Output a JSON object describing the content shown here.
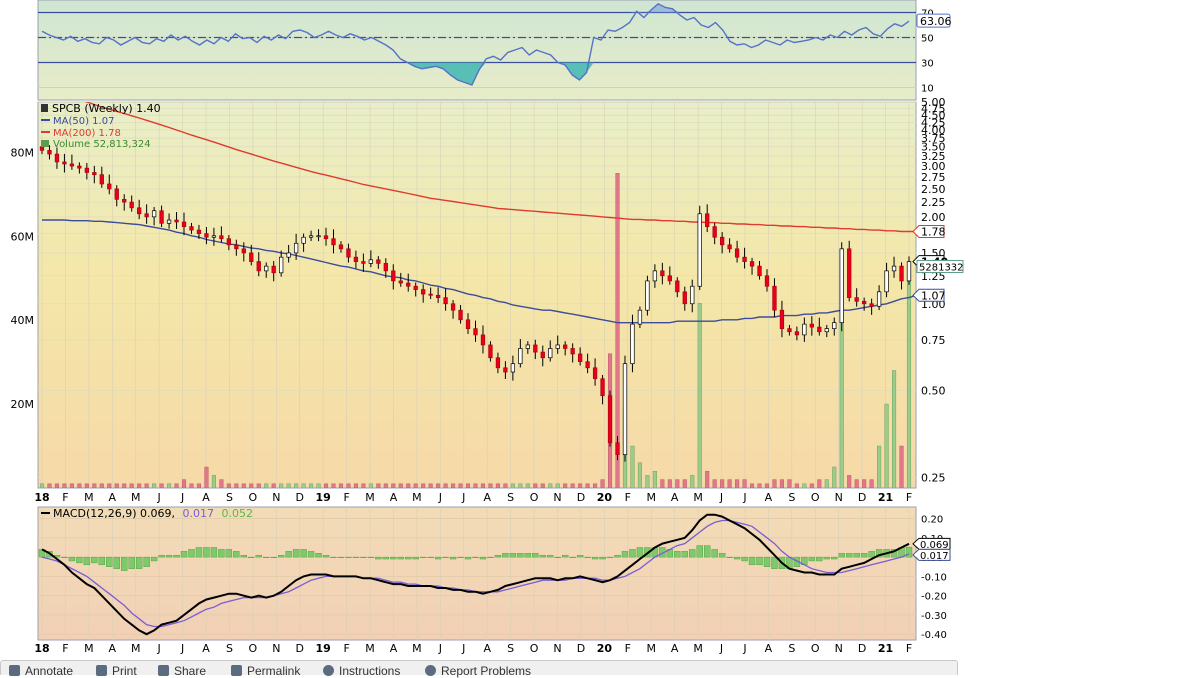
{
  "chart_data": [
    {
      "panel": "rsi",
      "type": "line",
      "y_ticks": [
        "70",
        "50",
        "30",
        "10"
      ],
      "ylim": [
        0,
        80
      ],
      "reference_lines": [
        70,
        50,
        30
      ],
      "current_value_label": "63.06",
      "series": [
        {
          "values": [
            55,
            52,
            50,
            48,
            51,
            47,
            49,
            46,
            45,
            50,
            48,
            44,
            47,
            50,
            46,
            45,
            49,
            47,
            52,
            48,
            51,
            47,
            44,
            48,
            45,
            50,
            47,
            53,
            49,
            50,
            46,
            51,
            48,
            52,
            49,
            55,
            56,
            54,
            50,
            52,
            55,
            52,
            50,
            53,
            51,
            48,
            50,
            47,
            44,
            40,
            33,
            30,
            27,
            25,
            26,
            27,
            25,
            20,
            16,
            14,
            12,
            24,
            33,
            35,
            32,
            38,
            40,
            42,
            36,
            40,
            38,
            36,
            30,
            28,
            20,
            16,
            22,
            50,
            48,
            56,
            55,
            58,
            62,
            71,
            66,
            72,
            77,
            74,
            73,
            68,
            64,
            66,
            60,
            58,
            62,
            56,
            47,
            44,
            45,
            42,
            44,
            48,
            46,
            44,
            48,
            46,
            47,
            48,
            50,
            48,
            52,
            50,
            55,
            52,
            56,
            58,
            53,
            51,
            57,
            61,
            59,
            63.06
          ]
        }
      ]
    },
    {
      "panel": "price",
      "type": "candlestick",
      "legend": {
        "title": "SPCB (Weekly) 1.40",
        "ma50": "MA(50) 1.07",
        "ma200": "MA(200) 1.78",
        "volume": "Volume 52,813,324"
      },
      "y_scale": "log",
      "ylim": [
        0.23,
        5.0
      ],
      "price_ticks": [
        "5.00",
        "4.75",
        "4.50",
        "4.25",
        "4.00",
        "3.75",
        "3.50",
        "3.25",
        "3.00",
        "2.75",
        "2.50",
        "2.25",
        "2.00",
        "1.75",
        "1.50",
        "1.25",
        "1.00",
        "0.75",
        "0.50",
        "0.25"
      ],
      "volume_ticks": [
        "80M",
        "60M",
        "40M",
        "20M"
      ],
      "volume_ylim": [
        0,
        92
      ],
      "value_labels": {
        "ma200": "1.78",
        "close": "1.40",
        "ma50": "1.07",
        "volume": "5281332"
      },
      "x_ticks": [
        "18",
        "F",
        "M",
        "A",
        "M",
        "J",
        "J",
        "A",
        "S",
        "O",
        "N",
        "D",
        "19",
        "F",
        "M",
        "A",
        "M",
        "J",
        "J",
        "A",
        "S",
        "O",
        "N",
        "D",
        "20",
        "F",
        "M",
        "A",
        "M",
        "J",
        "J",
        "A",
        "S",
        "O",
        "N",
        "D",
        "21",
        "F"
      ],
      "close": [
        3.4,
        3.3,
        3.1,
        3.05,
        3.0,
        2.95,
        2.85,
        2.8,
        2.6,
        2.5,
        2.3,
        2.25,
        2.15,
        2.05,
        2.0,
        2.1,
        1.9,
        1.95,
        1.92,
        1.85,
        1.8,
        1.75,
        1.7,
        1.72,
        1.68,
        1.6,
        1.55,
        1.5,
        1.4,
        1.3,
        1.35,
        1.28,
        1.45,
        1.5,
        1.62,
        1.7,
        1.72,
        1.72,
        1.68,
        1.6,
        1.55,
        1.45,
        1.4,
        1.38,
        1.42,
        1.38,
        1.3,
        1.2,
        1.18,
        1.15,
        1.12,
        1.08,
        1.07,
        1.05,
        1.0,
        0.95,
        0.88,
        0.82,
        0.78,
        0.72,
        0.65,
        0.6,
        0.58,
        0.62,
        0.7,
        0.72,
        0.68,
        0.65,
        0.7,
        0.72,
        0.7,
        0.67,
        0.63,
        0.6,
        0.55,
        0.48,
        0.33,
        0.3,
        0.62,
        0.85,
        0.95,
        1.2,
        1.3,
        1.25,
        1.2,
        1.1,
        1.0,
        1.15,
        2.05,
        1.85,
        1.7,
        1.6,
        1.55,
        1.45,
        1.4,
        1.35,
        1.25,
        1.15,
        0.95,
        0.82,
        0.8,
        0.78,
        0.85,
        0.83,
        0.8,
        0.82,
        0.86,
        1.55,
        1.05,
        1.02,
        1.0,
        0.98,
        1.1,
        1.3,
        1.35,
        1.2,
        1.4
      ],
      "volume": [
        1,
        1,
        1,
        1,
        1,
        1,
        1,
        1,
        1,
        1,
        1,
        1,
        1,
        1,
        1,
        1,
        1,
        1,
        1,
        2,
        1,
        1,
        5,
        3,
        2,
        1,
        1,
        1,
        1,
        1,
        1,
        1,
        1,
        1,
        1,
        1,
        1,
        1,
        1,
        1,
        1,
        1,
        1,
        1,
        1,
        1,
        1,
        1,
        1,
        1,
        1,
        1,
        1,
        1,
        1,
        1,
        1,
        1,
        1,
        1,
        1,
        1,
        1,
        1,
        1,
        1,
        1,
        1,
        1,
        1,
        1,
        1,
        1,
        1,
        1,
        2,
        32,
        75,
        18,
        10,
        6,
        3,
        4,
        2,
        2,
        2,
        2,
        3,
        44,
        4,
        2,
        2,
        2,
        2,
        2,
        1,
        1,
        1,
        2,
        2,
        2,
        1,
        1,
        1,
        2,
        2,
        5,
        55,
        3,
        2,
        2,
        2,
        10,
        20,
        28,
        10,
        52.8
      ],
      "ma50": [
        1.95,
        1.95,
        1.95,
        1.95,
        1.94,
        1.94,
        1.94,
        1.93,
        1.93,
        1.92,
        1.91,
        1.9,
        1.89,
        1.88,
        1.86,
        1.84,
        1.82,
        1.8,
        1.77,
        1.75,
        1.72,
        1.7,
        1.67,
        1.65,
        1.63,
        1.61,
        1.6,
        1.58,
        1.56,
        1.55,
        1.53,
        1.52,
        1.5,
        1.49,
        1.47,
        1.45,
        1.43,
        1.41,
        1.39,
        1.37,
        1.35,
        1.34,
        1.32,
        1.3,
        1.29,
        1.27,
        1.25,
        1.24,
        1.23,
        1.21,
        1.2,
        1.18,
        1.16,
        1.15,
        1.13,
        1.12,
        1.1,
        1.08,
        1.07,
        1.05,
        1.04,
        1.02,
        1.01,
        0.99,
        0.98,
        0.97,
        0.96,
        0.95,
        0.95,
        0.94,
        0.93,
        0.92,
        0.91,
        0.9,
        0.89,
        0.88,
        0.87,
        0.86,
        0.86,
        0.86,
        0.86,
        0.86,
        0.86,
        0.86,
        0.86,
        0.87,
        0.87,
        0.87,
        0.87,
        0.87,
        0.87,
        0.88,
        0.88,
        0.88,
        0.89,
        0.89,
        0.9,
        0.9,
        0.9,
        0.91,
        0.91,
        0.91,
        0.92,
        0.92,
        0.93,
        0.93,
        0.94,
        0.95,
        0.95,
        0.96,
        0.97,
        0.98,
        0.99,
        1.0,
        1.02,
        1.04,
        1.05,
        1.07
      ],
      "ma200": [
        5.6,
        5.5,
        5.4,
        5.3,
        5.2,
        5.1,
        5.0,
        4.9,
        4.8,
        4.72,
        4.64,
        4.56,
        4.48,
        4.4,
        4.32,
        4.24,
        4.16,
        4.08,
        4.0,
        3.92,
        3.84,
        3.77,
        3.7,
        3.63,
        3.56,
        3.49,
        3.42,
        3.36,
        3.3,
        3.24,
        3.18,
        3.12,
        3.07,
        3.02,
        2.97,
        2.92,
        2.87,
        2.83,
        2.79,
        2.75,
        2.71,
        2.67,
        2.63,
        2.59,
        2.56,
        2.53,
        2.5,
        2.47,
        2.44,
        2.41,
        2.38,
        2.35,
        2.32,
        2.3,
        2.28,
        2.26,
        2.24,
        2.22,
        2.2,
        2.18,
        2.16,
        2.14,
        2.13,
        2.12,
        2.11,
        2.1,
        2.09,
        2.08,
        2.07,
        2.06,
        2.05,
        2.04,
        2.03,
        2.02,
        2.01,
        2.0,
        1.99,
        1.98,
        1.97,
        1.96,
        1.96,
        1.95,
        1.95,
        1.94,
        1.94,
        1.93,
        1.93,
        1.92,
        1.92,
        1.91,
        1.91,
        1.9,
        1.9,
        1.89,
        1.89,
        1.88,
        1.88,
        1.87,
        1.87,
        1.86,
        1.86,
        1.85,
        1.85,
        1.84,
        1.84,
        1.83,
        1.83,
        1.82,
        1.82,
        1.81,
        1.81,
        1.8,
        1.8,
        1.79,
        1.79,
        1.78,
        1.78,
        1.78
      ]
    },
    {
      "panel": "macd",
      "type": "line",
      "legend": {
        "macd": "MACD(12,26,9) 0.069,",
        "signal": "0.017",
        "hist": "0.052"
      },
      "y_ticks": [
        "0.20",
        "0.10",
        "0.00",
        "-0.10",
        "-0.20",
        "-0.30",
        "-0.40"
      ],
      "ylim": [
        -0.43,
        0.26
      ],
      "value_labels": {
        "macd": "0.069",
        "signal": "0.017"
      },
      "x_ticks": [
        "18",
        "F",
        "M",
        "A",
        "M",
        "J",
        "J",
        "A",
        "S",
        "O",
        "N",
        "D",
        "19",
        "F",
        "M",
        "A",
        "M",
        "J",
        "J",
        "A",
        "S",
        "O",
        "N",
        "D",
        "20",
        "F",
        "M",
        "A",
        "M",
        "J",
        "J",
        "A",
        "S",
        "O",
        "N",
        "D",
        "21",
        "F"
      ],
      "series": [
        {
          "name": "MACD",
          "values": [
            0.04,
            0.02,
            -0.01,
            -0.04,
            -0.08,
            -0.11,
            -0.14,
            -0.16,
            -0.2,
            -0.24,
            -0.28,
            -0.32,
            -0.35,
            -0.38,
            -0.4,
            -0.38,
            -0.35,
            -0.34,
            -0.33,
            -0.3,
            -0.27,
            -0.24,
            -0.22,
            -0.21,
            -0.2,
            -0.19,
            -0.19,
            -0.2,
            -0.21,
            -0.2,
            -0.21,
            -0.2,
            -0.18,
            -0.15,
            -0.12,
            -0.1,
            -0.09,
            -0.09,
            -0.09,
            -0.1,
            -0.1,
            -0.1,
            -0.1,
            -0.11,
            -0.11,
            -0.12,
            -0.13,
            -0.14,
            -0.14,
            -0.15,
            -0.15,
            -0.15,
            -0.15,
            -0.16,
            -0.16,
            -0.17,
            -0.17,
            -0.18,
            -0.18,
            -0.19,
            -0.18,
            -0.17,
            -0.15,
            -0.14,
            -0.13,
            -0.12,
            -0.11,
            -0.11,
            -0.11,
            -0.12,
            -0.11,
            -0.11,
            -0.1,
            -0.11,
            -0.12,
            -0.13,
            -0.12,
            -0.1,
            -0.07,
            -0.04,
            -0.01,
            0.02,
            0.05,
            0.07,
            0.08,
            0.09,
            0.1,
            0.14,
            0.19,
            0.22,
            0.22,
            0.21,
            0.19,
            0.17,
            0.15,
            0.12,
            0.09,
            0.05,
            0.01,
            -0.03,
            -0.06,
            -0.07,
            -0.08,
            -0.08,
            -0.09,
            -0.09,
            -0.09,
            -0.06,
            -0.05,
            -0.04,
            -0.03,
            -0.01,
            0.01,
            0.02,
            0.03,
            0.05,
            0.069
          ]
        },
        {
          "name": "Signal",
          "values": [
            0.0,
            -0.01,
            -0.02,
            -0.04,
            -0.06,
            -0.08,
            -0.1,
            -0.13,
            -0.16,
            -0.19,
            -0.22,
            -0.25,
            -0.29,
            -0.32,
            -0.35,
            -0.36,
            -0.36,
            -0.35,
            -0.34,
            -0.33,
            -0.31,
            -0.29,
            -0.27,
            -0.26,
            -0.24,
            -0.23,
            -0.22,
            -0.21,
            -0.21,
            -0.21,
            -0.21,
            -0.2,
            -0.19,
            -0.18,
            -0.16,
            -0.14,
            -0.12,
            -0.11,
            -0.1,
            -0.1,
            -0.1,
            -0.1,
            -0.1,
            -0.11,
            -0.11,
            -0.11,
            -0.12,
            -0.13,
            -0.13,
            -0.14,
            -0.14,
            -0.15,
            -0.15,
            -0.15,
            -0.16,
            -0.16,
            -0.17,
            -0.17,
            -0.18,
            -0.18,
            -0.18,
            -0.18,
            -0.17,
            -0.16,
            -0.15,
            -0.14,
            -0.13,
            -0.12,
            -0.12,
            -0.12,
            -0.12,
            -0.11,
            -0.11,
            -0.11,
            -0.11,
            -0.12,
            -0.12,
            -0.11,
            -0.1,
            -0.08,
            -0.06,
            -0.03,
            0.0,
            0.02,
            0.04,
            0.06,
            0.07,
            0.1,
            0.13,
            0.16,
            0.18,
            0.19,
            0.19,
            0.18,
            0.17,
            0.16,
            0.13,
            0.1,
            0.07,
            0.03,
            0.0,
            -0.02,
            -0.04,
            -0.06,
            -0.07,
            -0.08,
            -0.08,
            -0.08,
            -0.07,
            -0.06,
            -0.05,
            -0.04,
            -0.03,
            -0.02,
            -0.01,
            0.0,
            0.017
          ]
        }
      ]
    }
  ],
  "toolbar": {
    "items": [
      {
        "label": "Annotate",
        "icon": "pencil-icon"
      },
      {
        "label": "Print",
        "icon": "printer-icon"
      },
      {
        "label": "Share",
        "icon": "share-icon"
      },
      {
        "label": "Permalink",
        "icon": "link-icon"
      },
      {
        "label": "Instructions",
        "icon": "info-icon"
      },
      {
        "label": "Report Problems",
        "icon": "help-icon"
      }
    ]
  },
  "colors": {
    "up_candle": "#ffffff",
    "down_candle": "#e8001c",
    "wick": "#000000",
    "ma50": "#3b4c9c",
    "ma200": "#e03a2f",
    "rsi_line": "#5572c8",
    "macd_line": "#000000",
    "signal_line": "#7a5cd6",
    "hist_fill": "#7ec96a",
    "volume_up": "#9ccb8c",
    "volume_down": "#e0788a"
  }
}
